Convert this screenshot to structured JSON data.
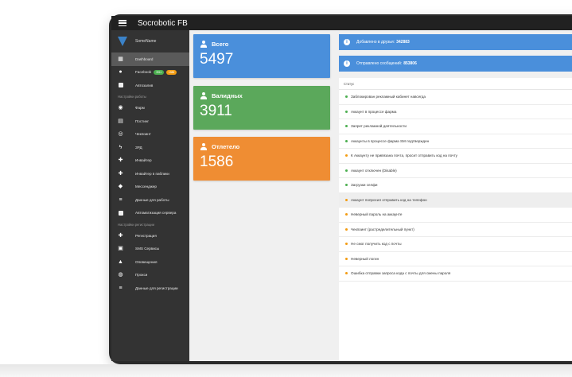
{
  "app": {
    "title": "Socrobotic FB"
  },
  "profile": {
    "name": "SomeName"
  },
  "sidebar": {
    "items": [
      {
        "label": "Dashboard",
        "icon": "dashboard-icon",
        "active": true
      },
      {
        "label": "Facebook",
        "icon": "facebook-icon",
        "badges": [
          "3911",
          "1586"
        ]
      },
      {
        "label": "Автозалив",
        "icon": "briefcase-icon"
      }
    ],
    "work_section": "Настройки работы",
    "work_items": [
      {
        "label": "Фарм",
        "icon": "robot-icon"
      },
      {
        "label": "Постинг",
        "icon": "post-icon"
      },
      {
        "label": "Чекпоинт",
        "icon": "broadcast-icon"
      },
      {
        "label": "ЗРД",
        "icon": "flash-icon"
      },
      {
        "label": "Инвайтер",
        "icon": "group-add-icon"
      },
      {
        "label": "Инвайтер в паблики",
        "icon": "group-add-icon"
      },
      {
        "label": "Мессенджер",
        "icon": "chat-icon"
      },
      {
        "label": "Данные для работы",
        "icon": "database-icon"
      },
      {
        "label": "Автоматизация сервера",
        "icon": "window-icon"
      }
    ],
    "reg_section": "Настройки регистрации",
    "reg_items": [
      {
        "label": "Регистрация",
        "icon": "users-icon"
      },
      {
        "label": "SMS Сервисы",
        "icon": "sms-icon"
      },
      {
        "label": "Оповещения",
        "icon": "bell-icon"
      },
      {
        "label": "Прокси",
        "icon": "globe-icon"
      },
      {
        "label": "Данные для регистрации",
        "icon": "database-icon"
      }
    ]
  },
  "cards": {
    "total": {
      "title": "Всего",
      "value": "5497",
      "color": "#4a8fdb"
    },
    "valid": {
      "title": "Валидных",
      "value": "3911",
      "color": "#5ba85b"
    },
    "dropped": {
      "title": "Отлетело",
      "value": "1586",
      "color": "#ef8d33"
    }
  },
  "info": {
    "friends": {
      "label": "Добавлено в друзья:",
      "value": "342883"
    },
    "messages": {
      "label": "Отправлено сообщений:",
      "value": "853806"
    }
  },
  "status": {
    "header": "Статус",
    "rows": [
      {
        "text": "Заблокирован рекламный кабинет навсегда",
        "color": "#4caf50"
      },
      {
        "text": "Аккаунт в процессе фарма",
        "color": "#4caf50"
      },
      {
        "text": "Запрет рекламной деятельности",
        "color": "#4caf50"
      },
      {
        "text": "Аккаунты в процессе фарма SM подтвержден",
        "color": "#4caf50"
      },
      {
        "text": "К Аккаунту не привязана почта, просит отправить код на почту",
        "color": "#f39c12"
      },
      {
        "text": "Аккаунт отключен (Disable)",
        "color": "#4caf50"
      },
      {
        "text": "Загрузки селфи",
        "color": "#4caf50"
      },
      {
        "text": "Аккаунт попросил отправить код на телефон",
        "color": "#f39c12",
        "highlight": true
      },
      {
        "text": "Неверный пароль на аккаунте",
        "color": "#f39c12"
      },
      {
        "text": "Чекпоинт (растределительный пункт)",
        "color": "#f39c12"
      },
      {
        "text": "Не смог получить код с почты",
        "color": "#f39c12"
      },
      {
        "text": "Неверный логин",
        "color": "#f39c12"
      },
      {
        "text": "Ошибка отправки запроса кода с почты для смены пароля",
        "color": "#f39c12"
      }
    ]
  }
}
